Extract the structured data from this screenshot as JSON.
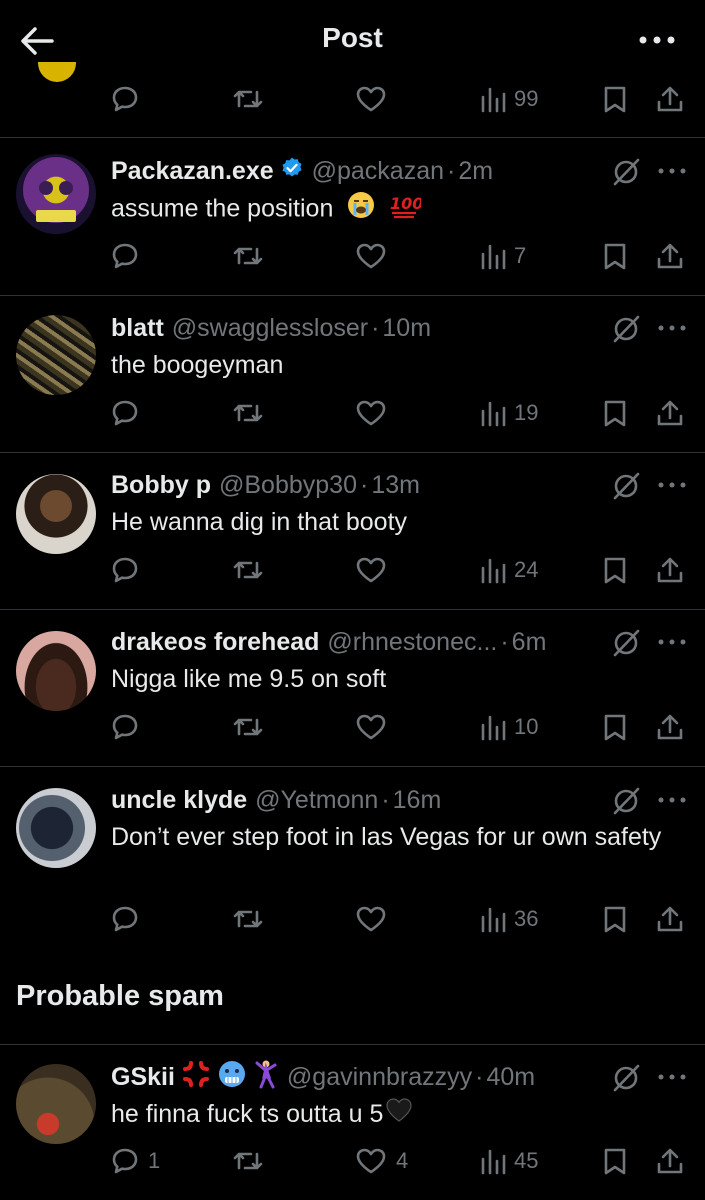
{
  "header": {
    "title": "Post"
  },
  "top_stats": {
    "views": "99"
  },
  "replies": [
    {
      "name": "Packazan.exe",
      "handle": "@packazan",
      "time": "2m",
      "text": "assume the position",
      "replies": "",
      "likes": "",
      "views": "7"
    },
    {
      "name": "blatt",
      "handle": "@swagglessloser",
      "time": "10m",
      "text": "the boogeyman",
      "replies": "",
      "likes": "",
      "views": "19"
    },
    {
      "name": "Bobby p",
      "handle": "@Bobbyp30",
      "time": "13m",
      "text": "He wanna dig in that booty",
      "replies": "",
      "likes": "",
      "views": "24"
    },
    {
      "name": "drakeos forehead",
      "handle": "@rhnestonec...",
      "time": "6m",
      "text": "Nigga like me 9.5 on soft",
      "replies": "",
      "likes": "",
      "views": "10"
    },
    {
      "name": "uncle klyde",
      "handle": "@Yetmonn",
      "time": "16m",
      "text": "Don’t ever step foot in las Vegas for ur own safety",
      "replies": "",
      "likes": "",
      "views": "36"
    }
  ],
  "spam_section": {
    "title": "Probable spam"
  },
  "spam_reply": {
    "name": "GSkii",
    "handle": "@gavinnbrazzyy",
    "time": "40m",
    "text": "he finna fuck ts outta u 5",
    "replies": "1",
    "likes": "4",
    "views": "45"
  },
  "separator": "·",
  "icons": [
    "back-arrow-icon",
    "more-icon",
    "reply-icon",
    "repost-icon",
    "like-icon",
    "views-icon",
    "bookmark-icon",
    "share-icon",
    "grok-icon",
    "verified-badge-icon"
  ],
  "colors": {
    "background": "#000000",
    "text": "#e7e9ea",
    "muted": "#71767b",
    "divider": "#2f3336",
    "verified": "#1d9bf0"
  }
}
